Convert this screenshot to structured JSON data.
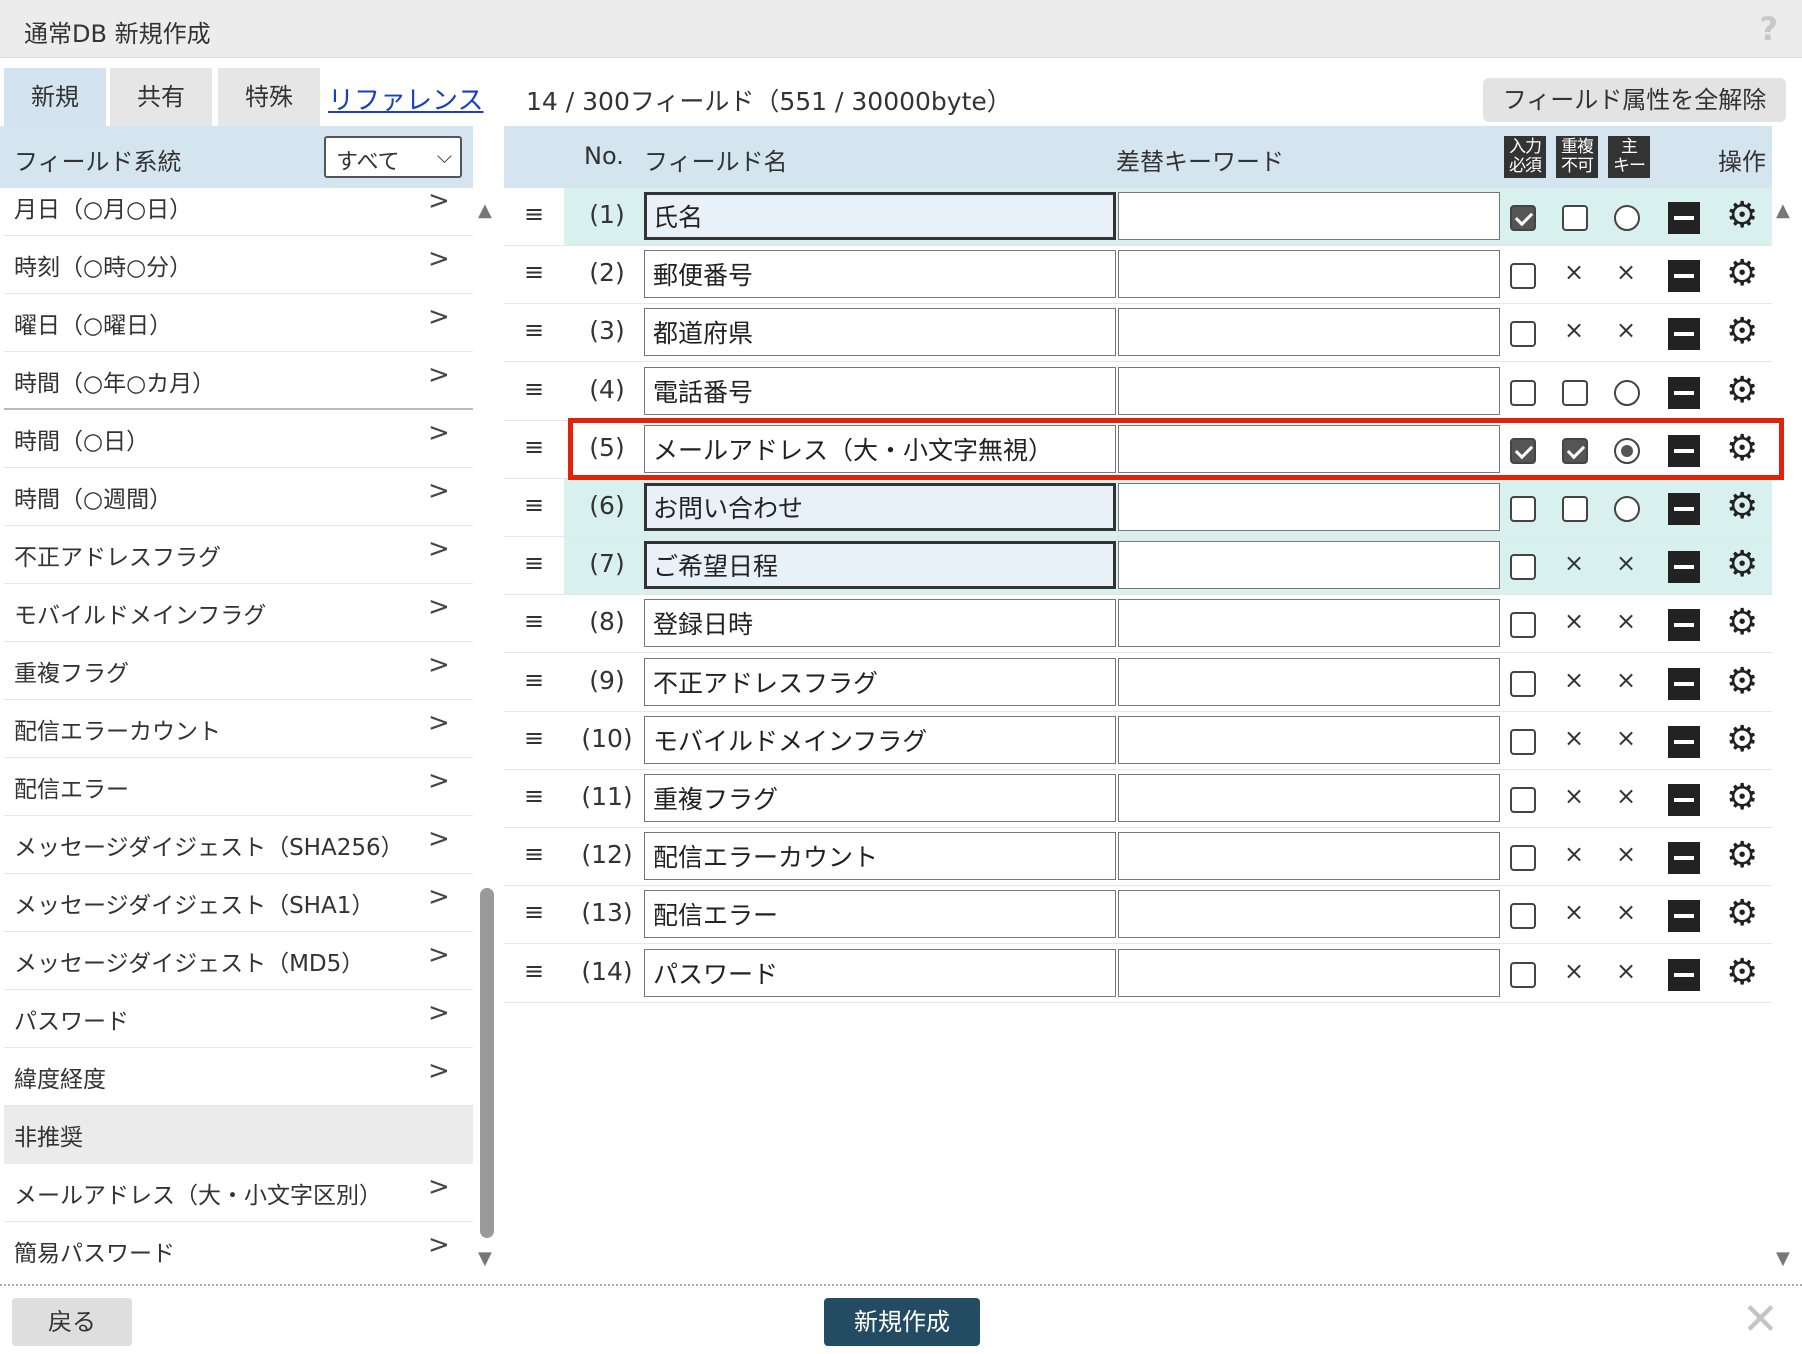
{
  "window": {
    "title": "通常DB 新規作成",
    "help": "?"
  },
  "tabs": [
    {
      "label": "新規",
      "active": true
    },
    {
      "label": "共有",
      "active": false
    },
    {
      "label": "特殊",
      "active": false
    }
  ],
  "reference_link": "リファレンス",
  "field_count": "14 / 300フィールド（551 / 30000byte）",
  "clear_attributes_button": "フィールド属性を全解除",
  "left_panel": {
    "header": "フィールド系統",
    "filter_value": "すべて",
    "items": [
      "月日（○月○日）",
      "時刻（○時○分）",
      "曜日（○曜日）",
      "時間（○年○カ月）",
      "時間（○日）",
      "時間（○週間）",
      "不正アドレスフラグ",
      "モバイルドメインフラグ",
      "重複フラグ",
      "配信エラーカウント",
      "配信エラー",
      "メッセージダイジェスト（SHA256）",
      "メッセージダイジェスト（SHA1）",
      "メッセージダイジェスト（MD5）",
      "パスワード",
      "緯度経度"
    ],
    "deprecated_section": "非推奨",
    "deprecated_items": [
      "メールアドレス（大・小文字区別）",
      "簡易パスワード"
    ],
    "arrow": ">"
  },
  "table": {
    "headers": {
      "no": "No.",
      "field_name": "フィールド名",
      "keyword": "差替キーワード",
      "required": "入力必須",
      "required_top": "入力",
      "required_bottom": "必須",
      "unique_top": "重複",
      "unique_bottom": "不可",
      "key_top": "主",
      "key_bottom": "キー",
      "operations": "操作"
    },
    "rows": [
      {
        "no": "(1)",
        "name": "氏名",
        "required": true,
        "unique": "off",
        "key": "off",
        "highlight": true,
        "focused": true
      },
      {
        "no": "(2)",
        "name": "郵便番号",
        "required": false,
        "unique": "na",
        "key": "na",
        "highlight": false,
        "focused": false
      },
      {
        "no": "(3)",
        "name": "都道府県",
        "required": false,
        "unique": "na",
        "key": "na",
        "highlight": false,
        "focused": false
      },
      {
        "no": "(4)",
        "name": "電話番号",
        "required": false,
        "unique": "off",
        "key": "off",
        "highlight": false,
        "focused": false
      },
      {
        "no": "(5)",
        "name": "メールアドレス（大・小文字無視）",
        "required": true,
        "unique": "on",
        "key": "on",
        "highlight": false,
        "focused": false,
        "selected": true
      },
      {
        "no": "(6)",
        "name": "お問い合わせ",
        "required": false,
        "unique": "off",
        "key": "off",
        "highlight": true,
        "focused": true
      },
      {
        "no": "(7)",
        "name": "ご希望日程",
        "required": false,
        "unique": "na",
        "key": "na",
        "highlight": true,
        "focused": true
      },
      {
        "no": "(8)",
        "name": "登録日時",
        "required": false,
        "unique": "na",
        "key": "na",
        "highlight": false,
        "focused": false
      },
      {
        "no": "(9)",
        "name": "不正アドレスフラグ",
        "required": false,
        "unique": "na",
        "key": "na",
        "highlight": false,
        "focused": false
      },
      {
        "no": "(10)",
        "name": "モバイルドメインフラグ",
        "required": false,
        "unique": "na",
        "key": "na",
        "highlight": false,
        "focused": false
      },
      {
        "no": "(11)",
        "name": "重複フラグ",
        "required": false,
        "unique": "na",
        "key": "na",
        "highlight": false,
        "focused": false
      },
      {
        "no": "(12)",
        "name": "配信エラーカウント",
        "required": false,
        "unique": "na",
        "key": "na",
        "highlight": false,
        "focused": false
      },
      {
        "no": "(13)",
        "name": "配信エラー",
        "required": false,
        "unique": "na",
        "key": "na",
        "highlight": false,
        "focused": false
      },
      {
        "no": "(14)",
        "name": "パスワード",
        "required": false,
        "unique": "na",
        "key": "na",
        "highlight": false,
        "focused": false
      }
    ],
    "drag_glyph": "≡",
    "na_glyph": "×",
    "gear_glyph": "⚙"
  },
  "colors": {
    "header_bg": "#d5e5f0",
    "highlight_row": "#d8f0ee",
    "selected_outline": "#e1230c",
    "primary_button": "#234c63",
    "link": "#1a3fbf"
  },
  "footer": {
    "back_button": "戻る",
    "create_button": "新規作成",
    "close_glyph": "✕"
  }
}
